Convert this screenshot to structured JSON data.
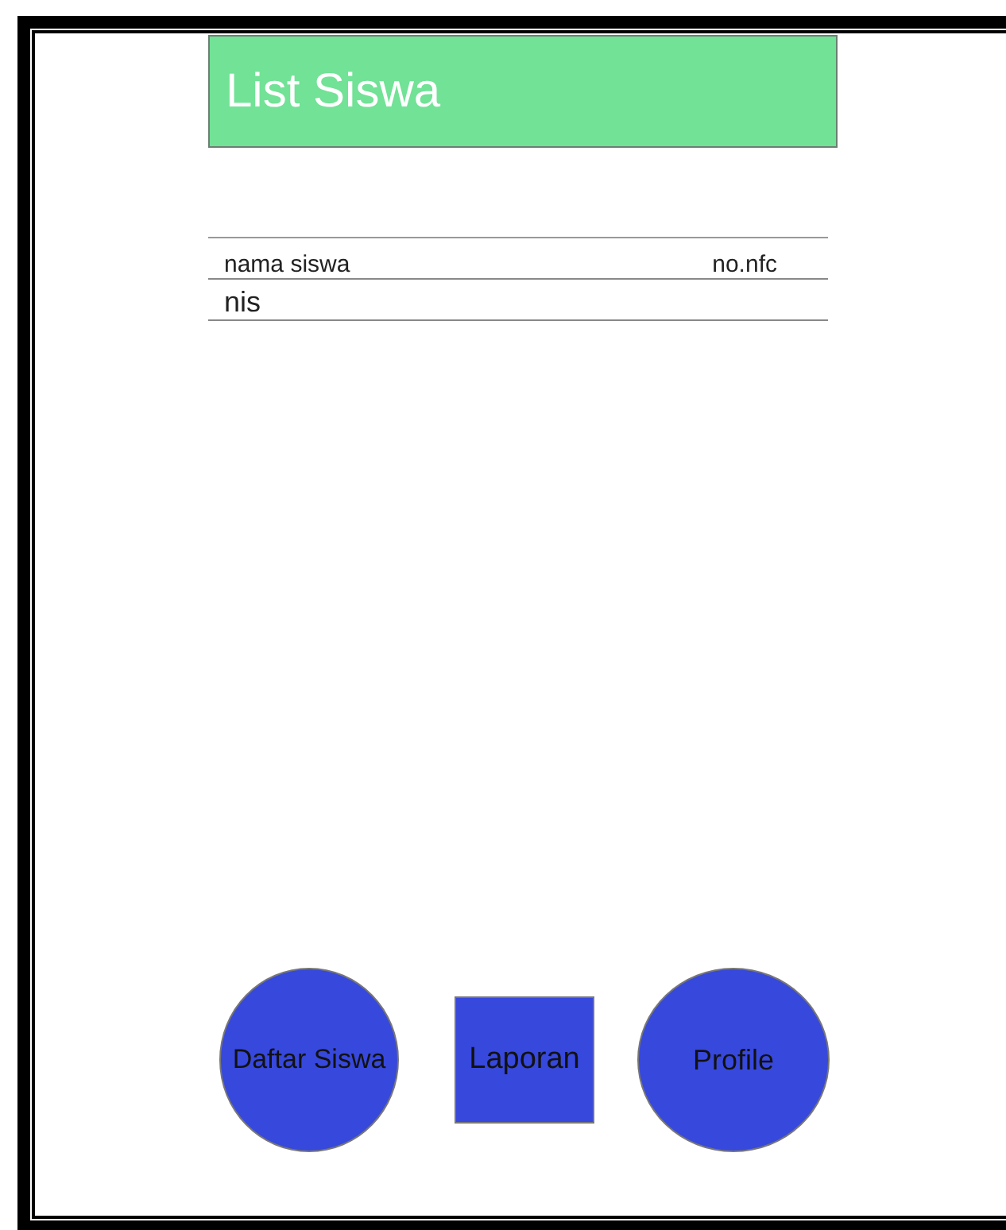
{
  "header": {
    "title": "List Siswa"
  },
  "table": {
    "rows": [
      {
        "cells": [
          "nama siswa",
          "no.nfc"
        ]
      },
      {
        "cells": [
          "nis"
        ]
      }
    ]
  },
  "buttons": [
    {
      "label": "Daftar Siswa",
      "kind": "circle"
    },
    {
      "label": "Laporan",
      "kind": "square"
    },
    {
      "label": "Profile",
      "kind": "circle"
    }
  ]
}
